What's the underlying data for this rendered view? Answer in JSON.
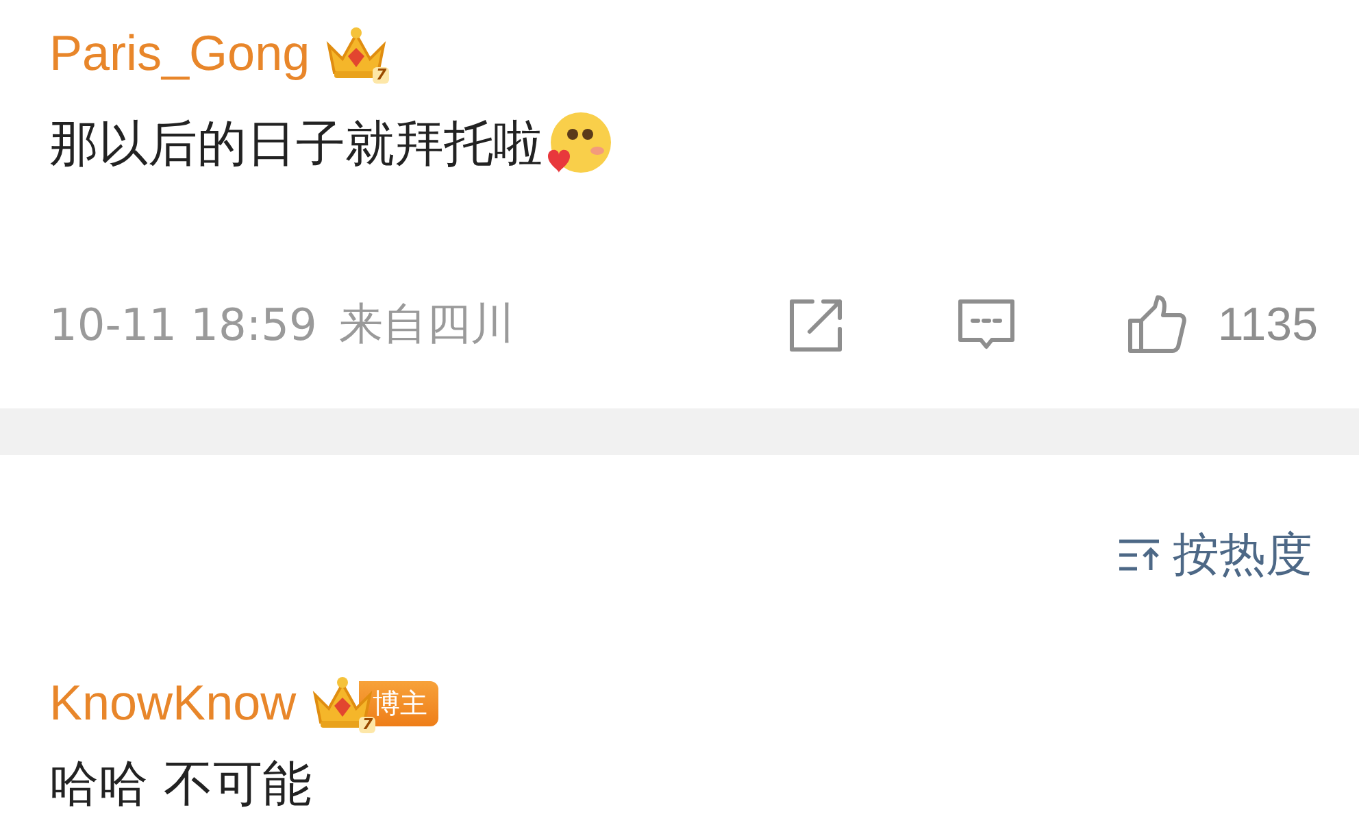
{
  "top_comment": {
    "username": "Paris_Gong",
    "crown_level": "7",
    "text": "那以后的日子就拜托啦",
    "emoji": true,
    "time": "10-11 18:59",
    "location": "来自四川",
    "likes": "1135"
  },
  "sort": {
    "label": "按热度"
  },
  "comments": [
    {
      "username": "KnowKnow",
      "crown_level": "7",
      "badge": "博主",
      "text": "哈哈 不可能"
    }
  ]
}
